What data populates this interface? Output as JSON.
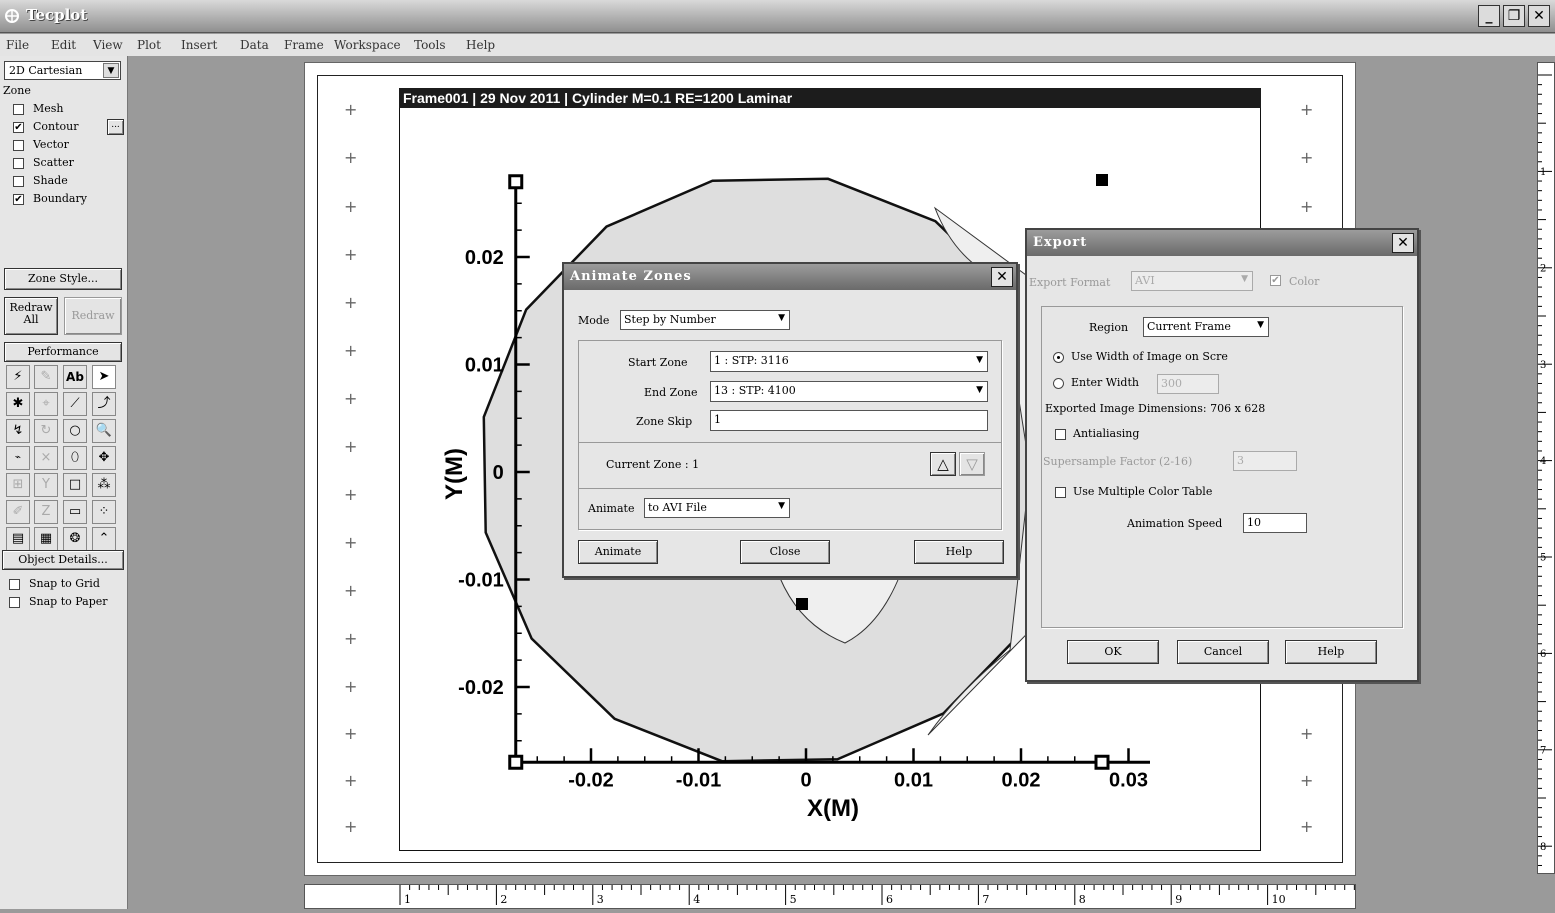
{
  "app": {
    "title": "Tecplot"
  },
  "menu": [
    "File",
    "Edit",
    "View",
    "Plot",
    "Insert",
    "Data",
    "Frame",
    "Workspace",
    "Tools",
    "Help"
  ],
  "sidebar": {
    "plot_type": "2D Cartesian",
    "zone_label": "Zone",
    "layers": [
      {
        "label": "Mesh",
        "checked": false
      },
      {
        "label": "Contour",
        "checked": true
      },
      {
        "label": "Vector",
        "checked": false
      },
      {
        "label": "Scatter",
        "checked": false
      },
      {
        "label": "Shade",
        "checked": false
      },
      {
        "label": "Boundary",
        "checked": true
      }
    ],
    "zone_style": "Zone Style...",
    "redraw_all": "Redraw All",
    "redraw": "Redraw",
    "performance": "Performance",
    "object_details": "Object Details...",
    "snap_grid": "Snap to Grid",
    "snap_paper": "Snap to Paper"
  },
  "frame": {
    "header": "Frame001  | 29 Nov 2011  | Cylinder M=0.1  RE=1200 Laminar"
  },
  "chart_data": {
    "type": "contour",
    "xlabel": "X(M)",
    "ylabel": "Y(M)",
    "x_ticks": [
      "-0.02",
      "-0.01",
      "0",
      "0.01",
      "0.02",
      "0.03"
    ],
    "y_ticks": [
      "0.02",
      "0.01",
      "0",
      "-0.01",
      "-0.02"
    ],
    "xlim": [
      -0.027,
      0.032
    ],
    "ylim": [
      -0.027,
      0.027
    ]
  },
  "rulers": {
    "h": [
      "1",
      "2",
      "3",
      "4",
      "5",
      "6",
      "7",
      "8",
      "9",
      "10"
    ],
    "v": [
      "1",
      "2",
      "3",
      "4",
      "5",
      "6",
      "7",
      "8"
    ]
  },
  "animate": {
    "title": "Animate Zones",
    "mode_label": "Mode",
    "mode_value": "Step by Number",
    "start_label": "Start Zone",
    "start_value": "1 : STP: 3116",
    "end_label": "End Zone",
    "end_value": "13 : STP: 4100",
    "skip_label": "Zone Skip",
    "skip_value": "1",
    "current_zone": "Current Zone : 1",
    "animate_label": "Animate",
    "animate_value": "to AVI File",
    "btn_animate": "Animate",
    "btn_close": "Close",
    "btn_help": "Help"
  },
  "export": {
    "title": "Export",
    "format_label": "Export Format",
    "format_value": "AVI",
    "color_label": "Color",
    "region_label": "Region",
    "region_value": "Current Frame",
    "use_width": "Use Width of Image on Scre",
    "enter_width": "Enter Width",
    "width_value": "300",
    "dimensions": "Exported Image Dimensions: 706 x 628",
    "antialiasing": "Antialiasing",
    "supersample_label": "Supersample Factor (2-16)",
    "supersample_value": "3",
    "multi_color": "Use Multiple Color Table",
    "speed_label": "Animation Speed",
    "speed_value": "10",
    "btn_ok": "OK",
    "btn_cancel": "Cancel",
    "btn_help": "Help"
  }
}
